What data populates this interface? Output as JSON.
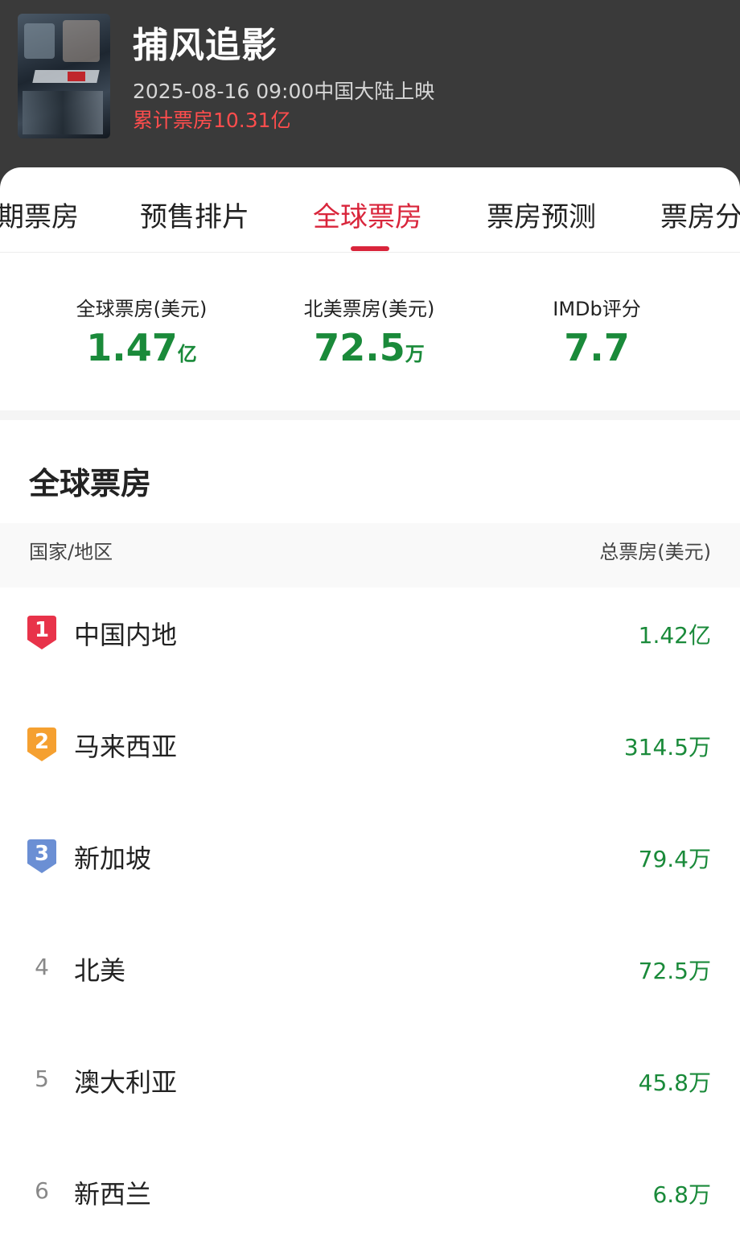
{
  "movie": {
    "title": "捕风追影",
    "release": "2025-08-16 09:00中国大陆上映",
    "cumulative": "累计票房10.31亿"
  },
  "tabs": [
    {
      "label": "期票房"
    },
    {
      "label": "预售排片"
    },
    {
      "label": "全球票房",
      "active": true
    },
    {
      "label": "票房预测"
    },
    {
      "label": "票房分"
    }
  ],
  "stats": [
    {
      "label": "全球票房(美元)",
      "value": "1.47",
      "unit": "亿"
    },
    {
      "label": "北美票房(美元)",
      "value": "72.5",
      "unit": "万"
    },
    {
      "label": "IMDb评分",
      "value": "7.7",
      "unit": ""
    }
  ],
  "section": {
    "title": "全球票房",
    "col_region": "国家/地区",
    "col_gross": "总票房(美元)"
  },
  "rows": [
    {
      "rank": "1",
      "region": "中国内地",
      "gross": "1.42亿"
    },
    {
      "rank": "2",
      "region": "马来西亚",
      "gross": "314.5万"
    },
    {
      "rank": "3",
      "region": "新加坡",
      "gross": "79.4万"
    },
    {
      "rank": "4",
      "region": "北美",
      "gross": "72.5万"
    },
    {
      "rank": "5",
      "region": "澳大利亚",
      "gross": "45.8万"
    },
    {
      "rank": "6",
      "region": "新西兰",
      "gross": "6.8万"
    }
  ],
  "colors": {
    "accent": "#d9253b",
    "value_green": "#1a8a3a",
    "header_bg": "#3a3a3a",
    "cumulative_red": "#ff4d4d",
    "rank1": "#e8334a",
    "rank2": "#f5a030",
    "rank3": "#6b8fd4"
  }
}
